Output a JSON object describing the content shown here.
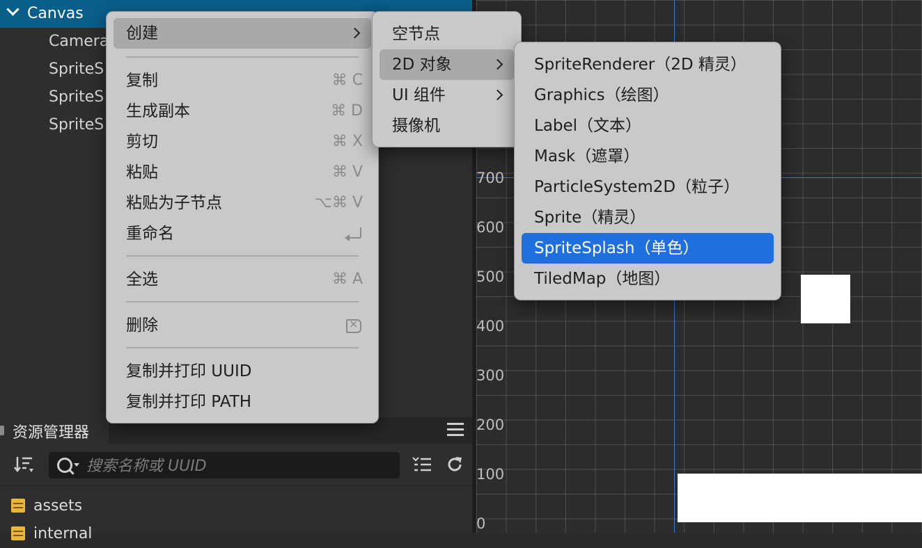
{
  "hierarchy": {
    "root": "Canvas",
    "children": [
      "Camera",
      "SpriteS",
      "SpriteS",
      "SpriteS"
    ]
  },
  "context_menu": {
    "items": [
      {
        "label": "创建",
        "shortcut": ""
      },
      {
        "label": "复制",
        "shortcut": "⌘ C"
      },
      {
        "label": "生成副本",
        "shortcut": "⌘ D"
      },
      {
        "label": "剪切",
        "shortcut": "⌘ X"
      },
      {
        "label": "粘贴",
        "shortcut": "⌘ V"
      },
      {
        "label": "粘贴为子节点",
        "shortcut": "⌥⌘ V"
      },
      {
        "label": "重命名",
        "shortcut": ""
      },
      {
        "label": "全选",
        "shortcut": "⌘ A"
      },
      {
        "label": "删除",
        "shortcut": ""
      },
      {
        "label": "复制并打印 UUID",
        "shortcut": ""
      },
      {
        "label": "复制并打印 PATH",
        "shortcut": ""
      }
    ]
  },
  "create_submenu": {
    "items": [
      "空节点",
      "2D 对象",
      "UI 组件",
      "摄像机"
    ]
  },
  "object2d_submenu": {
    "items": [
      "SpriteRenderer（2D 精灵）",
      "Graphics（绘图）",
      "Label（文本）",
      "Mask（遮罩）",
      "ParticleSystem2D（粒子）",
      "Sprite（精灵）",
      "SpriteSplash（单色）",
      "TiledMap（地图）"
    ],
    "selected": "SpriteSplash（单色）"
  },
  "scene": {
    "y_axis_labels": [
      "700",
      "600",
      "500",
      "400",
      "300",
      "200",
      "100",
      "0"
    ]
  },
  "assets_panel": {
    "title": "资源管理器",
    "search_placeholder": "搜索名称或 UUID",
    "items": [
      "assets",
      "internal"
    ]
  },
  "colors": {
    "accent": "#1f6fde",
    "selection": "#0a5e8a",
    "folder": "#e9b53a"
  }
}
